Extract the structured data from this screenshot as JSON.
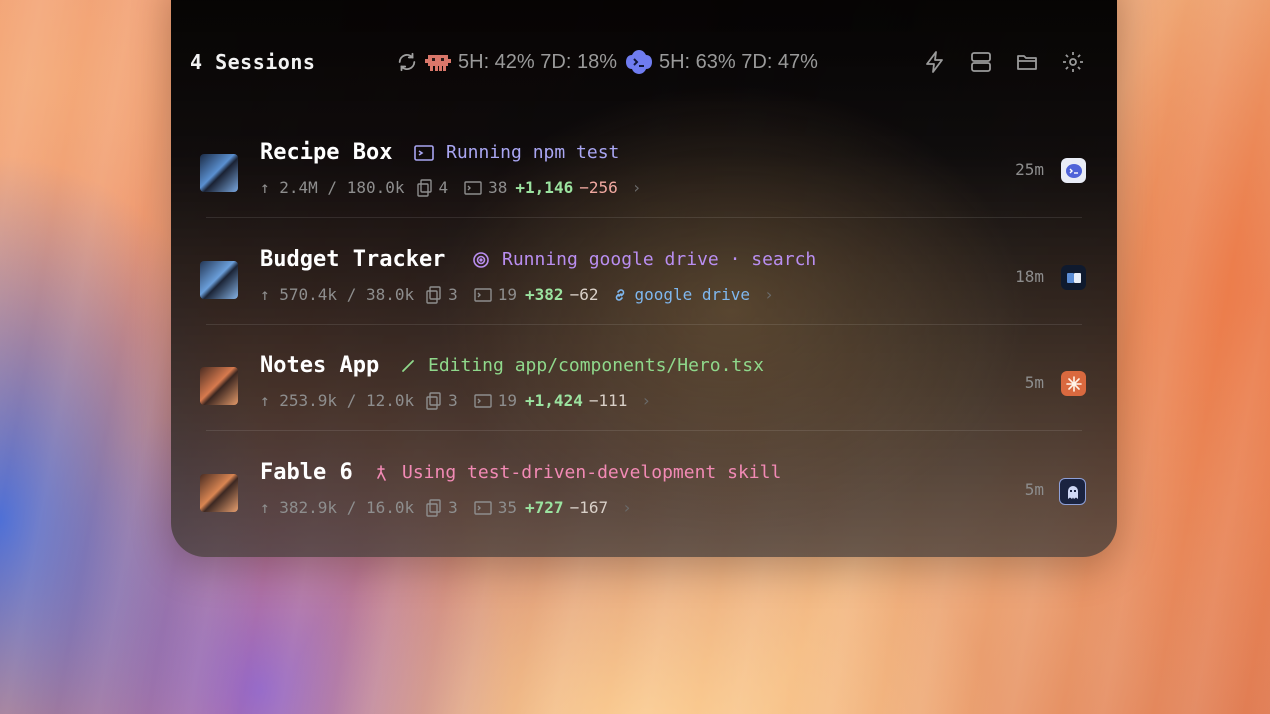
{
  "header": {
    "title": "4 Sessions",
    "usage": [
      {
        "icon": "claude-crab-icon",
        "text": "5H: 42% 7D: 18%"
      },
      {
        "icon": "codex-cloud-icon",
        "text": "5H: 63% 7D: 47%"
      }
    ],
    "toolbar": [
      "bolt-icon",
      "layout-icon",
      "folder-icon",
      "gear-icon"
    ]
  },
  "sessions": [
    {
      "name": "Recipe Box",
      "activity_icon": "terminal-icon",
      "activity": "Running npm test",
      "activity_color": "#a9a6f2",
      "tokens": "↑ 2.4M / 180.0k",
      "files": "4",
      "terminals": "38",
      "added": "+1,146",
      "removed": "−256",
      "elapsed": "25m",
      "app": "codex-app-icon"
    },
    {
      "name": "Budget Tracker",
      "activity_icon": "spiral-icon",
      "activity": "Running google drive · search",
      "activity_color": "#b98ef0",
      "tokens": "↑ 570.4k / 38.0k",
      "files": "3",
      "terminals": "19",
      "added": "+382",
      "removed": "−62",
      "link": "google drive",
      "elapsed": "18m",
      "app": "cursor-app-icon"
    },
    {
      "name": "Notes App",
      "activity_icon": "pencil-icon",
      "activity": "Editing app/components/Hero.tsx",
      "activity_color": "#8fd88b",
      "tokens": "↑ 253.9k / 12.0k",
      "files": "3",
      "terminals": "19",
      "added": "+1,424",
      "removed": "−111",
      "elapsed": "5m",
      "app": "claude-app-icon"
    },
    {
      "name": "Fable 6",
      "activity_icon": "sparkle-icon",
      "activity": "Using test-driven-development skill",
      "activity_color": "#f28ab5",
      "tokens": "↑ 382.9k / 16.0k",
      "files": "3",
      "terminals": "35",
      "added": "+727",
      "removed": "−167",
      "elapsed": "5m",
      "app": "ghostty-app-icon"
    }
  ]
}
